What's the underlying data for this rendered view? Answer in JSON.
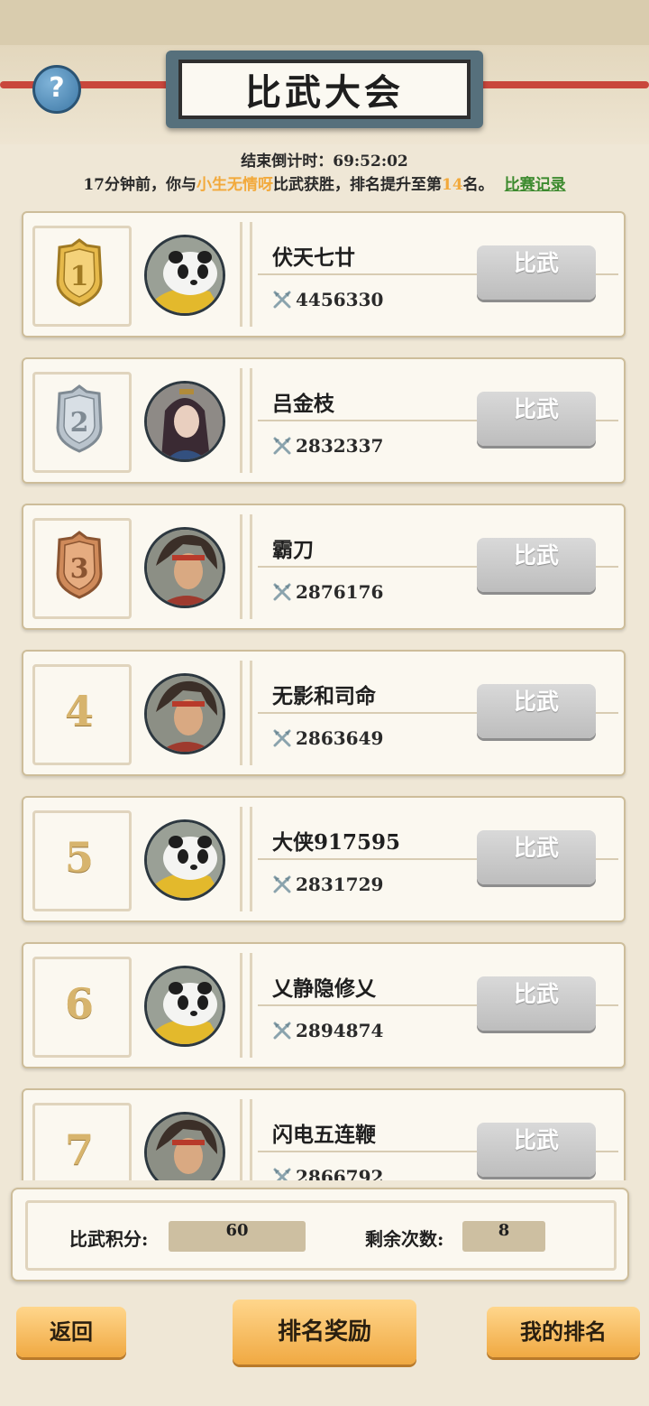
{
  "header": {
    "title": "比武大会",
    "help_icon": "?"
  },
  "countdown": {
    "label": "结束倒计时：",
    "time": "69:52:02"
  },
  "notice": {
    "prefix": "17分钟前，你与",
    "opponent": "小生无情呀",
    "middle": "比武获胜，排名提升至第",
    "rank": "14",
    "suffix": "名。",
    "record_link": "比赛记录"
  },
  "colors": {
    "highlight": "#f2a93b",
    "link": "#3c8a2e",
    "button_gold": "#f0a942"
  },
  "ranking": [
    {
      "rank": "1",
      "badge": "gold",
      "avatar": "panda",
      "name": "伏天七廿",
      "power": "4456330",
      "button": "比武"
    },
    {
      "rank": "2",
      "badge": "silver",
      "avatar": "lady",
      "name": "吕金枝",
      "power": "2832337",
      "button": "比武"
    },
    {
      "rank": "3",
      "badge": "bronze",
      "avatar": "warrior",
      "name": "霸刀",
      "power": "2876176",
      "button": "比武"
    },
    {
      "rank": "4",
      "badge": "none",
      "avatar": "warrior",
      "name": "无影和司命",
      "power": "2863649",
      "button": "比武"
    },
    {
      "rank": "5",
      "badge": "none",
      "avatar": "panda",
      "name": "大侠917595",
      "power": "2831729",
      "button": "比武"
    },
    {
      "rank": "6",
      "badge": "none",
      "avatar": "panda",
      "name": "乂静隐修乂",
      "power": "2894874",
      "button": "比武"
    },
    {
      "rank": "7",
      "badge": "none",
      "avatar": "warrior",
      "name": "闪电五连鞭",
      "power": "2866792",
      "button": "比武"
    }
  ],
  "stats": {
    "points_label": "比武积分:",
    "points_value": "60",
    "remaining_label": "剩余次数:",
    "remaining_value": "8"
  },
  "footer": {
    "back": "返回",
    "rank_reward": "排名奖励",
    "my_rank": "我的排名"
  }
}
